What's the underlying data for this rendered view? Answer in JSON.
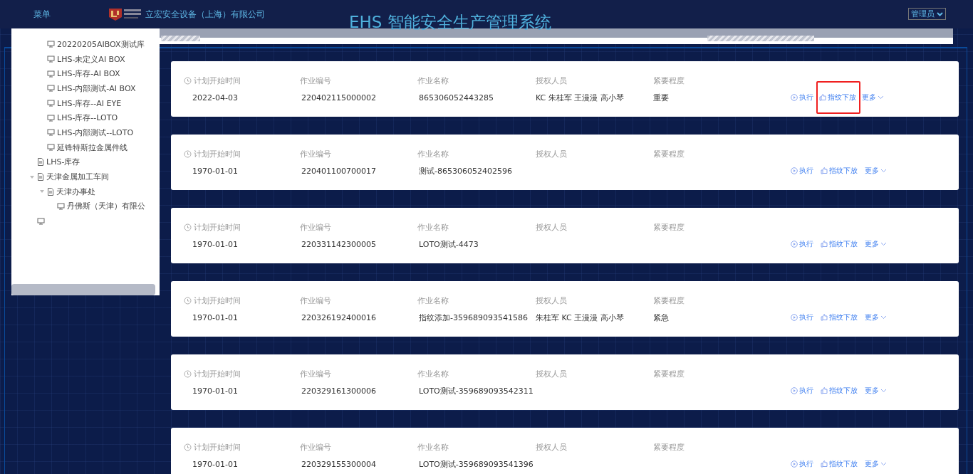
{
  "header": {
    "menu": "菜单",
    "company": "立宏安全设备（上海）有限公司",
    "title": "EHS 智能安全生产管理系统",
    "user": "管理员"
  },
  "tree": [
    {
      "kind": "group",
      "children": [
        {
          "kind": "device",
          "label": "20220205AIBOX测试库"
        },
        {
          "kind": "device",
          "label": "LHS-未定义AI BOX"
        },
        {
          "kind": "device",
          "label": "LHS-库存-AI BOX"
        },
        {
          "kind": "device",
          "label": "LHS-内部测试-AI BOX"
        },
        {
          "kind": "device",
          "label": "LHS-库存--AI EYE"
        },
        {
          "kind": "device",
          "label": "LHS-库存--LOTO"
        },
        {
          "kind": "device",
          "label": "LHS-内部测试--LOTO"
        },
        {
          "kind": "device",
          "label": "延锋特斯拉金属件线"
        }
      ]
    },
    {
      "kind": "folder",
      "label": "LHS-库存"
    },
    {
      "kind": "folder",
      "label": "天津金属加工车间",
      "expanded": true,
      "children": [
        {
          "kind": "folder",
          "label": "天津办事处",
          "expanded": true,
          "children": [
            {
              "kind": "device",
              "label": "丹佛斯（天津）有限公"
            }
          ]
        }
      ]
    },
    {
      "kind": "device"
    }
  ],
  "jobs": [
    {
      "labels": [
        "计划开始时间",
        "作业编号",
        "作业名称",
        "授权人员",
        "紧要程度"
      ],
      "start": "2022-04-03",
      "number": "220402115000002",
      "name": "865306052443285",
      "people": "KC 朱桂军 王漫漫 高小琴",
      "urgency": "重要",
      "actions": [
        "执行",
        "指纹下放",
        "更多"
      ],
      "highlighted": true
    },
    {
      "labels": [
        "计划开始时间",
        "作业编号",
        "作业名称",
        "授权人员",
        "紧要程度"
      ],
      "start": "1970-01-01",
      "number": "220401100700017",
      "name": "测试-865306052402596",
      "actions": [
        "执行",
        "指纹下放",
        "更多"
      ],
      "highlighted": false
    },
    {
      "labels": [
        "计划开始时间",
        "作业编号",
        "作业名称",
        "授权人员",
        "紧要程度"
      ],
      "start": "1970-01-01",
      "number": "220331142300005",
      "name": "LOTO测试-4473",
      "actions": [
        "执行",
        "指纹下放",
        "更多"
      ],
      "highlighted": false
    },
    {
      "labels": [
        "计划开始时间",
        "作业编号",
        "作业名称",
        "授权人员",
        "紧要程度"
      ],
      "start": "1970-01-01",
      "number": "220326192400016",
      "name": "指纹添加-359689093541586",
      "people": "朱桂军 KC 王漫漫 高小琴",
      "urgency": "紧急",
      "actions": [
        "执行",
        "指纹下放",
        "更多"
      ],
      "highlighted": false
    },
    {
      "labels": [
        "计划开始时间",
        "作业编号",
        "作业名称",
        "授权人员",
        "紧要程度"
      ],
      "start": "1970-01-01",
      "number": "220329161300006",
      "name": "LOTO测试-359689093542311",
      "actions": [
        "执行",
        "指纹下放",
        "更多"
      ],
      "highlighted": false
    },
    {
      "labels": [
        "计划开始时间",
        "作业编号",
        "作业名称",
        "授权人员",
        "紧要程度"
      ],
      "start": "1970-01-01",
      "number": "220329155300004",
      "name": "LOTO测试-359689093541396",
      "actions": [
        "执行",
        "指纹下放",
        "更多"
      ],
      "highlighted": false
    }
  ]
}
